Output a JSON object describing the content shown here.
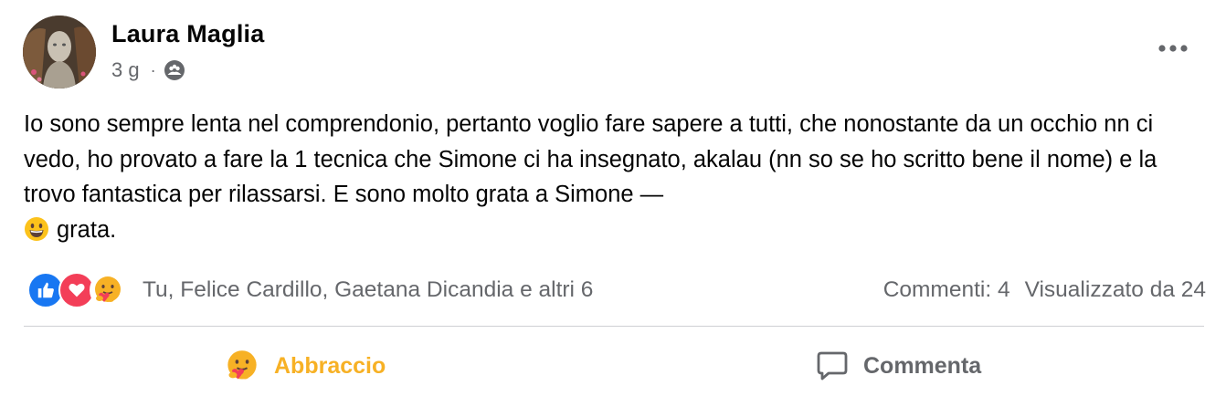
{
  "post": {
    "author": "Laura Maglia",
    "time": "3 g",
    "separator": "·",
    "privacy_icon": "group-audience-icon",
    "more_icon": "more-options-icon",
    "text_main": "Io sono sempre lenta nel comprendonio, pertanto voglio fare sapere a tutti, che nonostante da un occhio nn ci vedo, ho provato a fare la 1 tecnica che Simone ci ha insegnato, akalau (nn so se ho scritto bene il nome) e la trovo fantastica per rilassarsi. E sono molto grata a Simone —",
    "text_end": "grata.",
    "text_emoji": "grinning-face-emoji"
  },
  "reactions": {
    "icons": [
      "like-icon",
      "love-icon",
      "care-icon"
    ],
    "names": "Tu, Felice Cardillo, Gaetana Dicandia e altri 6",
    "comments": "Commenti: 4",
    "views": "Visualizzato da 24"
  },
  "actions": {
    "hug_label": "Abbraccio",
    "hug_icon": "care-hug-icon",
    "comment_label": "Commenta",
    "comment_icon": "comment-bubble-icon"
  },
  "colors": {
    "hug_active": "#f7b125",
    "secondary_text": "#65676b",
    "like_blue": "#1877f2",
    "love_red": "#f33e58"
  }
}
